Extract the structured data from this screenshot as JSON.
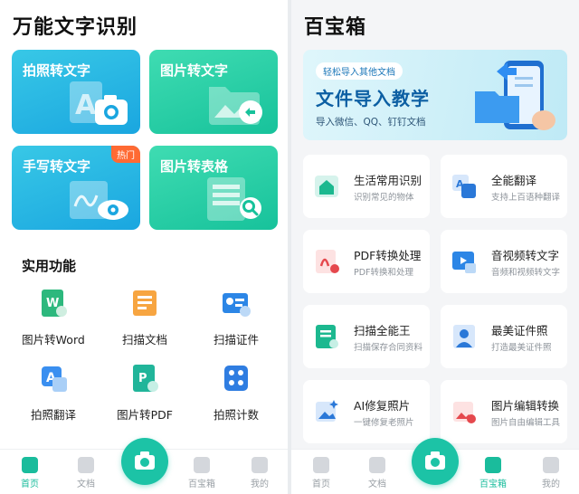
{
  "left": {
    "title": "万能文字识别",
    "cards": [
      {
        "label": "拍照转文字"
      },
      {
        "label": "图片转文字"
      },
      {
        "label": "手写转文字",
        "badge": "热门"
      },
      {
        "label": "图片转表格"
      }
    ],
    "section_title": "实用功能",
    "tools": [
      {
        "label": "图片转Word",
        "icon": "word-doc-icon"
      },
      {
        "label": "扫描文档",
        "icon": "scan-document-icon"
      },
      {
        "label": "扫描证件",
        "icon": "id-card-icon"
      },
      {
        "label": "拍照翻译",
        "icon": "translate-icon"
      },
      {
        "label": "图片转PDF",
        "icon": "pdf-file-icon"
      },
      {
        "label": "拍照计数",
        "icon": "count-grid-icon"
      }
    ],
    "nav": [
      {
        "label": "首页",
        "active": true
      },
      {
        "label": "文档"
      },
      {
        "label": "百宝箱"
      },
      {
        "label": "我的"
      }
    ]
  },
  "right": {
    "title": "百宝箱",
    "banner": {
      "tag": "轻松导入其他文档",
      "title": "文件导入教学",
      "subtitle": "导入微信、QQ、钉钉文档"
    },
    "tiles": [
      {
        "title": "生活常用识别",
        "subtitle": "识别常见的物体",
        "icon": "house-icon"
      },
      {
        "title": "全能翻译",
        "subtitle": "支持上百语种翻译",
        "icon": "translate-icon"
      },
      {
        "title": "PDF转换处理",
        "subtitle": "PDF转换和处理",
        "icon": "pdf-convert-icon"
      },
      {
        "title": "音视频转文字",
        "subtitle": "音频和视频转文字",
        "icon": "video-text-icon"
      },
      {
        "title": "扫描全能王",
        "subtitle": "扫描保存合同资料",
        "icon": "scan-file-icon"
      },
      {
        "title": "最美证件照",
        "subtitle": "打造最美证件照",
        "icon": "portrait-icon"
      },
      {
        "title": "AI修复照片",
        "subtitle": "一键修复老照片",
        "icon": "photo-repair-icon"
      },
      {
        "title": "图片编辑转换",
        "subtitle": "图片自由编辑工具",
        "icon": "image-edit-icon"
      }
    ],
    "nav": [
      {
        "label": "首页"
      },
      {
        "label": "文档"
      },
      {
        "label": "百宝箱",
        "active": true
      },
      {
        "label": "我的"
      }
    ]
  },
  "colors": {
    "accent": "#1cc3a6",
    "card_blue": "#1aa6e0",
    "card_green": "#17c29b",
    "hot_badge": "#ff6a33"
  }
}
